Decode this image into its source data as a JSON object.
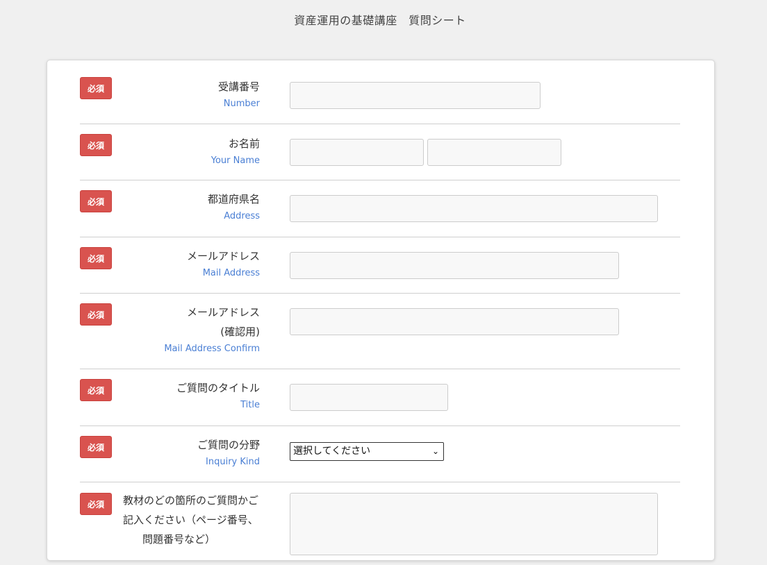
{
  "page": {
    "title": "資産運用の基礎講座　質問シート"
  },
  "required_label": "必須",
  "fields": [
    {
      "jp": "受講番号",
      "en": "Number"
    },
    {
      "jp": "お名前",
      "en": "Your Name"
    },
    {
      "jp": "都道府県名",
      "en": "Address"
    },
    {
      "jp": "メールアドレス",
      "en": "Mail Address"
    },
    {
      "jp": "メールアドレス",
      "jp2": "(確認用)",
      "en": "Mail Address Confirm"
    },
    {
      "jp": "ご質問のタイトル",
      "en": "Title"
    },
    {
      "jp": "ご質問の分野",
      "en": "Inquiry Kind",
      "select_value": "選択してください"
    },
    {
      "jp": "教材のどの箇所のご質問かご",
      "jp2": "記入ください（ページ番号、",
      "jp3": "問題番号など）"
    }
  ],
  "colors": {
    "badge": "#d9534f",
    "english_label": "#4a7fd4",
    "background": "#f0f0f0"
  },
  "icons": {
    "select": "chevron-down-icon"
  }
}
